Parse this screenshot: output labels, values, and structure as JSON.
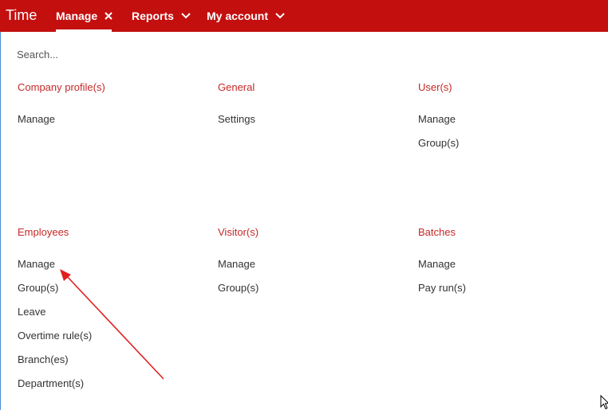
{
  "app": {
    "title": "Time"
  },
  "nav": {
    "items": [
      {
        "label": "Manage",
        "icon": "close-icon",
        "active": true
      },
      {
        "label": "Reports",
        "icon": "chevron-down-icon"
      },
      {
        "label": "My account",
        "icon": "chevron-down-icon"
      }
    ]
  },
  "search": {
    "placeholder": "Search..."
  },
  "sections": [
    {
      "title": "Company profile(s)",
      "links": [
        "Manage"
      ]
    },
    {
      "title": "General",
      "links": [
        "Settings"
      ]
    },
    {
      "title": "User(s)",
      "links": [
        "Manage",
        "Group(s)"
      ]
    },
    {
      "title": "Employees",
      "links": [
        "Manage",
        "Group(s)",
        "Leave",
        "Overtime rule(s)",
        "Branch(es)",
        "Department(s)"
      ]
    },
    {
      "title": "Visitor(s)",
      "links": [
        "Manage",
        "Group(s)"
      ]
    },
    {
      "title": "Batches",
      "links": [
        "Manage",
        "Pay run(s)"
      ]
    }
  ],
  "colors": {
    "topbar": "#c40f0f",
    "section_title": "#c62828",
    "annotation_arrow": "#e02020"
  }
}
